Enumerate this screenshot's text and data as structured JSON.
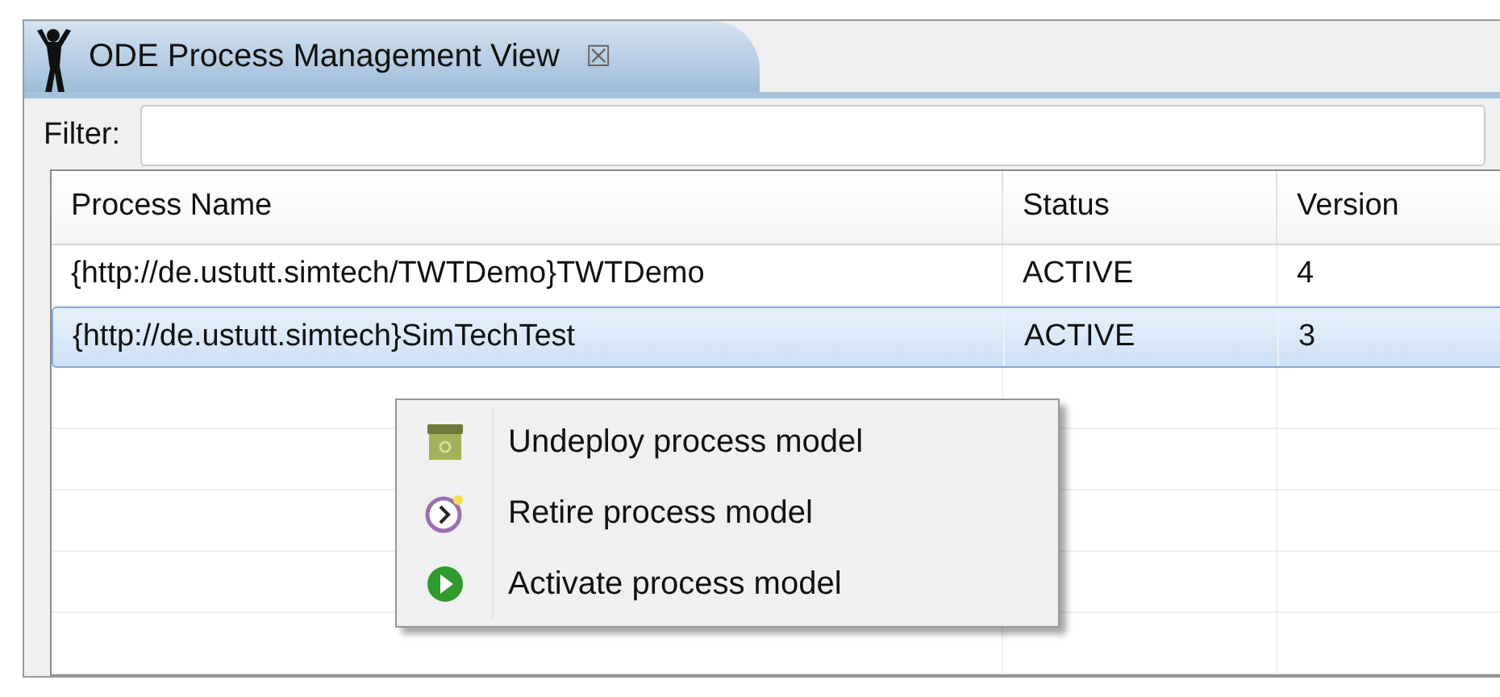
{
  "view_tab": {
    "title": "ODE Process Management View",
    "close": "☒"
  },
  "filter": {
    "label": "Filter:"
  },
  "table": {
    "columns": [
      "Process Name",
      "Status",
      "Version"
    ],
    "rows": [
      {
        "cells": [
          "{http://de.ustutt.simtech/TWTDemo}TWTDemo",
          "ACTIVE",
          "4"
        ],
        "selected": false
      },
      {
        "cells": [
          "{http://de.ustutt.simtech}SimTechTest",
          "ACTIVE",
          "3"
        ],
        "selected": true
      }
    ]
  },
  "context_menu": [
    {
      "label": "Undeploy process model",
      "kind": "undeploy"
    },
    {
      "label": "Retire process model",
      "kind": "retire"
    },
    {
      "label": "Activate process model",
      "kind": "activate"
    }
  ]
}
